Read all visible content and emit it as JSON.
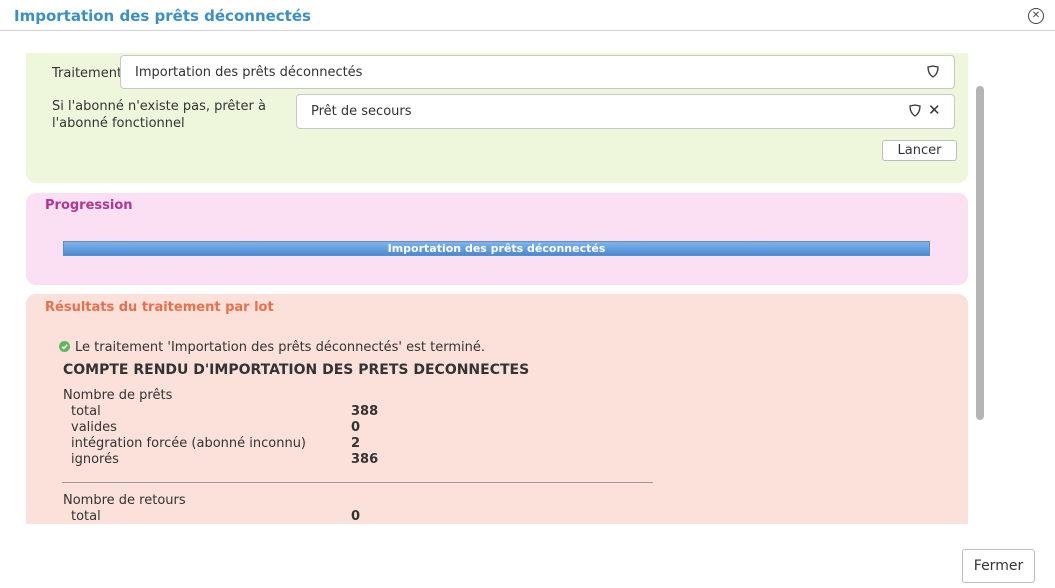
{
  "dialog": {
    "title": "Importation des prêts déconnectés",
    "close_icon": "close-circle-icon"
  },
  "form": {
    "traitement_label": "Traitement",
    "traitement_value": "Importation des prêts déconnectés",
    "abonne_label_line1": "Si l'abonné n'existe pas, prêter à",
    "abonne_label_line2": "l'abonné fonctionnel",
    "abonne_value": "Prêt de secours",
    "lancer_label": "Lancer"
  },
  "progression": {
    "title": "Progression",
    "bar_text": "Importation des prêts déconnectés",
    "percent": 100
  },
  "results": {
    "title": "Résultats du traitement par lot",
    "status_message": "Le traitement 'Importation des prêts déconnectés' est terminé.",
    "report_title": "COMPTE RENDU D'IMPORTATION DES PRETS DECONNECTES",
    "prets_heading": "Nombre de prêts",
    "prets_rows": [
      {
        "label": "total",
        "value": "388"
      },
      {
        "label": "valides",
        "value": "0"
      },
      {
        "label": "intégration forcée (abonné inconnu)",
        "value": "2"
      },
      {
        "label": "ignorés",
        "value": "386"
      }
    ],
    "retours_heading": "Nombre de retours",
    "retours_rows": [
      {
        "label": "total",
        "value": "0"
      }
    ]
  },
  "footer": {
    "fermer_label": "Fermer"
  },
  "colors": {
    "title_blue": "#3a8fc9",
    "progression_title": "#b2378f",
    "results_title": "#e8704a",
    "status_ok": "#5cb85c"
  }
}
